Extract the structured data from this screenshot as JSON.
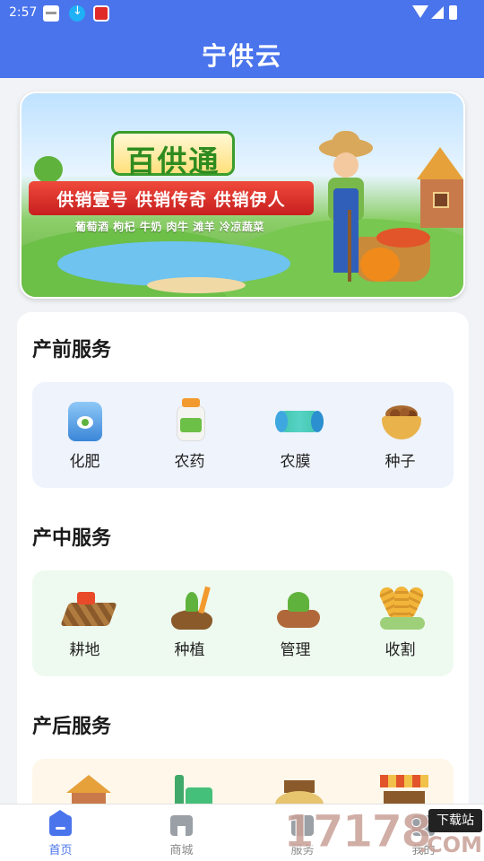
{
  "status_bar": {
    "time": "2:57"
  },
  "app": {
    "title": "宁供云"
  },
  "banner": {
    "brand": "百供通",
    "slogan": "供销壹号 供销传奇 供销伊人",
    "products": "葡萄酒  枸杞  牛奶 肉牛  滩羊 冷凉蔬菜"
  },
  "sections": [
    {
      "title": "产前服务",
      "items": [
        "化肥",
        "农药",
        "农膜",
        "种子"
      ]
    },
    {
      "title": "产中服务",
      "items": [
        "耕地",
        "种植",
        "管理",
        "收割"
      ]
    },
    {
      "title": "产后服务",
      "items": [
        "",
        "",
        "",
        ""
      ]
    }
  ],
  "tabs": [
    {
      "label": "首页",
      "icon": "home-icon",
      "active": true
    },
    {
      "label": "商城",
      "icon": "shop-icon",
      "active": false
    },
    {
      "label": "服务",
      "icon": "service-icon",
      "active": false
    },
    {
      "label": "我的",
      "icon": "profile-icon",
      "active": false
    }
  ],
  "watermark": {
    "number": "17178",
    "download": "下载站",
    "domain": ".COM"
  },
  "colors": {
    "primary": "#4a74ec",
    "pre_bg": "#eef3fc",
    "mid_bg": "#eefaef",
    "post_bg": "#fff7ea"
  }
}
